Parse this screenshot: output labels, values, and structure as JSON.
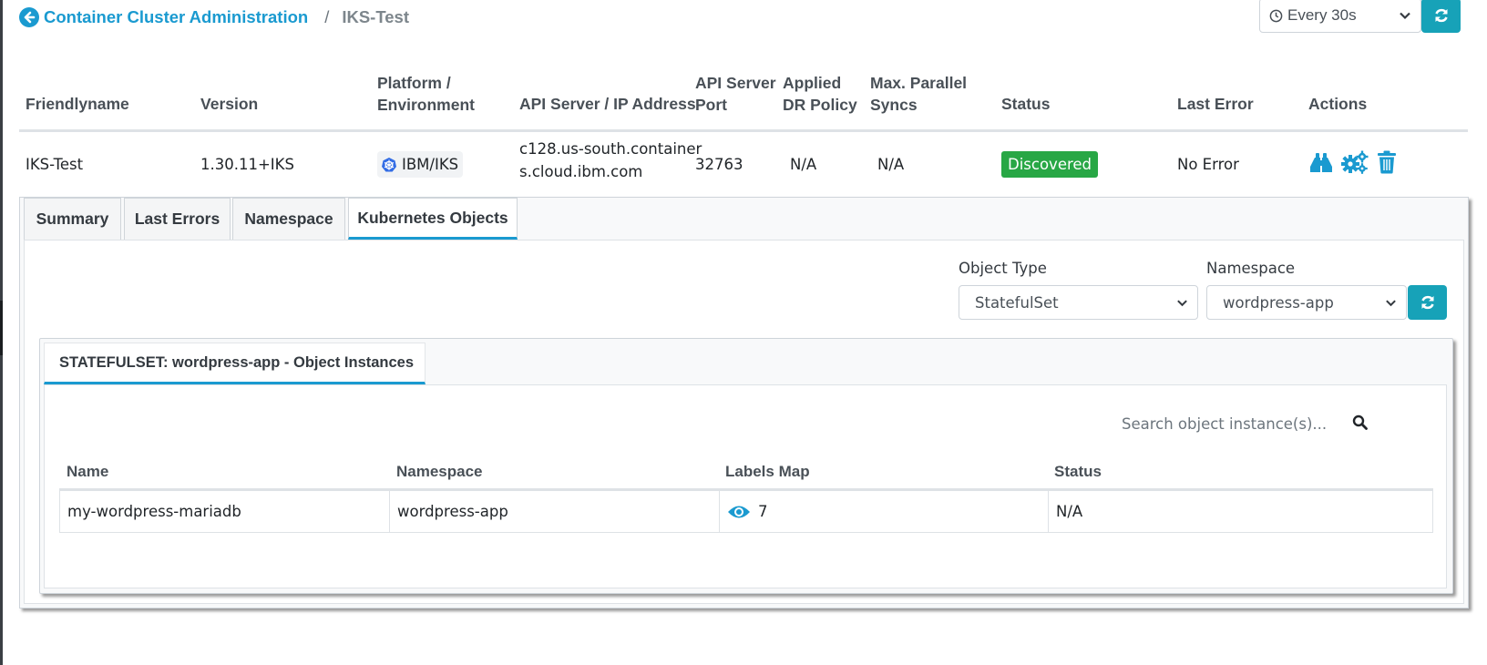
{
  "breadcrumb": {
    "parent": "Container Cluster Administration",
    "separator": "/",
    "current": "IKS-Test"
  },
  "refresh": {
    "interval": "Every 30s"
  },
  "table": {
    "headers": {
      "friendlyname": "Friendlyname",
      "version": "Version",
      "platform_1": "Platform /",
      "platform_2": "Environment",
      "api_server": "API Server / IP Address",
      "port_1": "API Server",
      "port_2": "Port",
      "dr_1": "Applied",
      "dr_2": "DR Policy",
      "syncs_1": "Max. Parallel",
      "syncs_2": "Syncs",
      "status": "Status",
      "last_error": "Last Error",
      "actions": "Actions"
    },
    "row": {
      "friendlyname": "IKS-Test",
      "version": "1.30.11+IKS",
      "platform": "IBM/IKS",
      "api_server_1": "c128.us-south.container",
      "api_server_2": "s.cloud.ibm.com",
      "port": "32763",
      "dr_policy": "N/A",
      "max_syncs": "N/A",
      "status": "Discovered",
      "last_error": "No Error"
    }
  },
  "tabs": [
    "Summary",
    "Last Errors",
    "Namespace",
    "Kubernetes Objects"
  ],
  "filters": {
    "object_type_label": "Object Type",
    "object_type_value": "StatefulSet",
    "namespace_label": "Namespace",
    "namespace_value": "wordpress-app"
  },
  "instances": {
    "title": "STATEFULSET: wordpress-app - Object Instances",
    "search_placeholder": "Search object instance(s)...",
    "headers": {
      "name": "Name",
      "namespace": "Namespace",
      "labels": "Labels Map",
      "status": "Status"
    },
    "rows": [
      {
        "name": "my-wordpress-mariadb",
        "namespace": "wordpress-app",
        "labels_count": "7",
        "status": "N/A"
      }
    ]
  },
  "colors": {
    "accent": "#1a9ad0",
    "teal": "#17a2b8",
    "success": "#28a745"
  },
  "icons": [
    "arrow-circle-left-icon",
    "clock-icon",
    "chevron-down-icon",
    "sync-icon",
    "kubernetes-icon",
    "binoculars-icon",
    "gears-icon",
    "trash-icon",
    "search-icon",
    "eye-icon"
  ]
}
